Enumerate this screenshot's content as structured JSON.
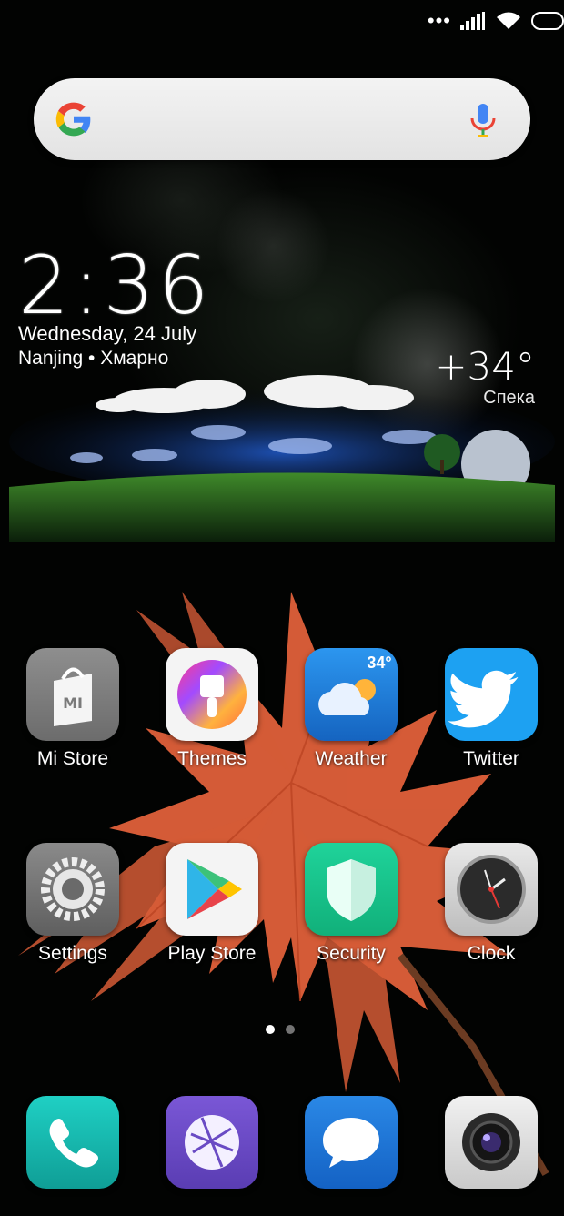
{
  "status_bar": {
    "icons": [
      "dots-icon",
      "signal-icon",
      "wifi-icon",
      "battery-icon"
    ]
  },
  "search": {
    "provider_icon": "google-icon",
    "voice_icon": "mic-icon"
  },
  "clock_widget": {
    "time": "2:36",
    "date": "Wednesday, 24 July",
    "location_line": "Nanjing • Хмарно"
  },
  "weather_widget": {
    "temperature": "+34°",
    "condition": "Спека"
  },
  "apps": [
    {
      "label": "Mi Store",
      "icon": "mi-store-icon"
    },
    {
      "label": "Themes",
      "icon": "themes-icon"
    },
    {
      "label": "Weather",
      "icon": "weather-icon",
      "badge": "34°"
    },
    {
      "label": "Twitter",
      "icon": "twitter-icon"
    },
    {
      "label": "Settings",
      "icon": "settings-icon"
    },
    {
      "label": "Play Store",
      "icon": "play-store-icon"
    },
    {
      "label": "Security",
      "icon": "security-icon"
    },
    {
      "label": "Clock",
      "icon": "clock-icon"
    }
  ],
  "page_indicator": {
    "pages": 2,
    "current": 1
  },
  "dock": [
    {
      "icon": "phone-icon"
    },
    {
      "icon": "browser-icon"
    },
    {
      "icon": "messages-icon"
    },
    {
      "icon": "camera-icon"
    }
  ],
  "colors": {
    "twitter": "#1da1f2",
    "weather": "#1e7fd8",
    "security": "#17c48c",
    "phone": "#14b8b0",
    "browser": "#6a4bc4",
    "messages": "#1a6fd0"
  }
}
